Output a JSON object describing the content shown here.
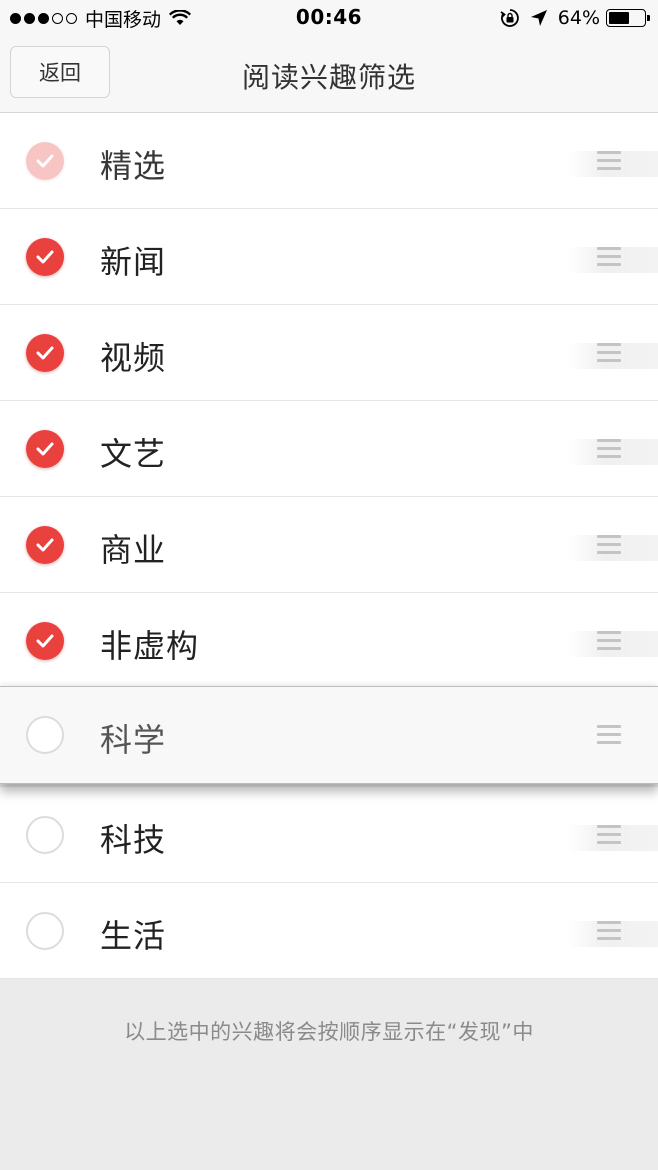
{
  "status_bar": {
    "carrier": "中国移动",
    "time": "00:46",
    "battery_percent": "64%",
    "battery_level": 0.64,
    "signal_bars_filled": 3,
    "signal_bars_total": 5
  },
  "nav": {
    "back_label": "返回",
    "title": "阅读兴趣筛选"
  },
  "items": [
    {
      "label": "精选",
      "checked": true,
      "faded": true
    },
    {
      "label": "新闻",
      "checked": true
    },
    {
      "label": "视频",
      "checked": true
    },
    {
      "label": "文艺",
      "checked": true
    },
    {
      "label": "商业",
      "checked": true
    },
    {
      "label": "非虚构",
      "checked": true
    },
    {
      "label": "科学",
      "checked": false,
      "dragging": true
    },
    {
      "label": "科技",
      "checked": false
    },
    {
      "label": "生活",
      "checked": false
    }
  ],
  "footer": {
    "note": "以上选中的兴趣将会按顺序显示在“发现”中"
  },
  "colors": {
    "accent": "#e8413e",
    "unchecked_ring": "#dcdcdc",
    "background": "#ebebeb"
  },
  "icons": {
    "check": "checkmark-icon",
    "drag": "drag-handle-icon",
    "wifi": "wifi-icon",
    "orientation_lock": "orientation-lock-icon",
    "location": "location-arrow-icon",
    "battery": "battery-icon"
  }
}
